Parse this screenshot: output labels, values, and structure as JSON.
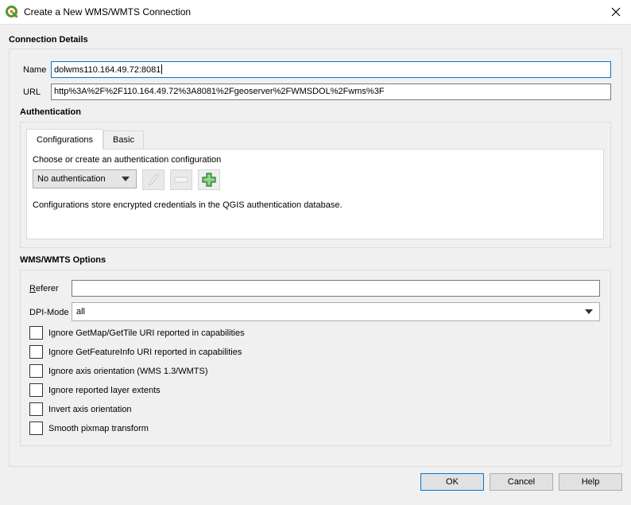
{
  "window": {
    "title": "Create a New WMS/WMTS Connection",
    "app_icon": "qgis-icon",
    "close_icon": "close-icon"
  },
  "connection": {
    "section_title": "Connection Details",
    "name_label": "Name",
    "name_value": "dolwms110.164.49.72:8081",
    "url_label": "URL",
    "url_value": "http%3A%2F%2F110.164.49.72%3A8081%2Fgeoserver%2FWMSDOL%2Fwms%3F"
  },
  "authentication": {
    "section_title": "Authentication",
    "tabs": [
      {
        "label": "Configurations",
        "active": true
      },
      {
        "label": "Basic",
        "active": false
      }
    ],
    "choose_text": "Choose or create an authentication configuration",
    "selected_config": "No authentication",
    "edit_icon": "pencil-icon",
    "remove_icon": "minus-icon",
    "add_icon": "plus-icon",
    "info_text": "Configurations store encrypted credentials in the QGIS authentication database."
  },
  "options": {
    "section_title": "WMS/WMTS Options",
    "referer_label": "Referer",
    "referer_value": "",
    "dpi_label": "DPI-Mode",
    "dpi_value": "all",
    "checkboxes": [
      {
        "label": "Ignore GetMap/GetTile URI reported in capabilities",
        "checked": false
      },
      {
        "label": "Ignore GetFeatureInfo URI reported in capabilities",
        "checked": false
      },
      {
        "label": "Ignore axis orientation (WMS 1.3/WMTS)",
        "checked": false
      },
      {
        "label": "Ignore reported layer extents",
        "checked": false
      },
      {
        "label": "Invert axis orientation",
        "checked": false
      },
      {
        "label": "Smooth pixmap transform",
        "checked": false
      }
    ]
  },
  "buttons": {
    "ok": "OK",
    "cancel": "Cancel",
    "help": "Help"
  },
  "colors": {
    "focus": "#0078d7",
    "qgis_green": "#589632",
    "add_green": "#3c9a3c"
  }
}
